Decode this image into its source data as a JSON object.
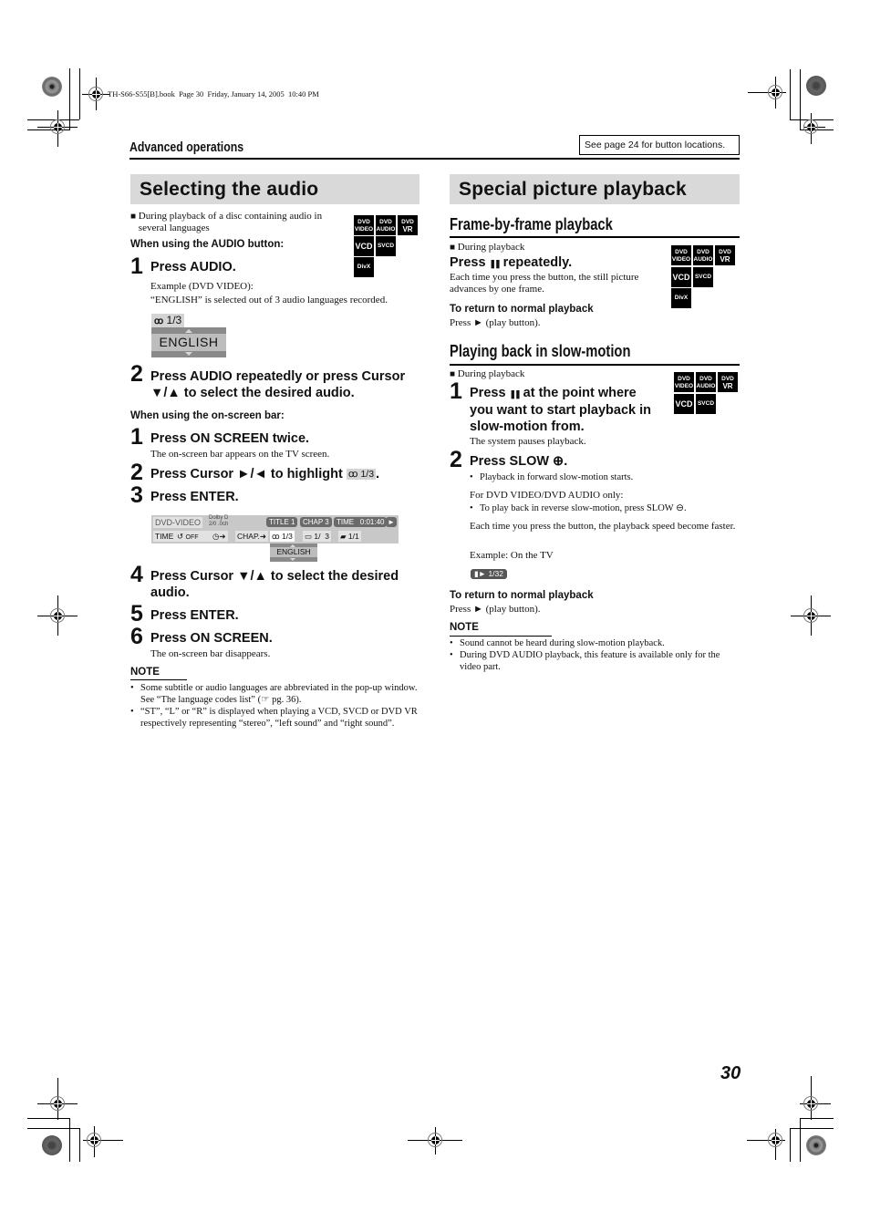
{
  "print_slug": "TH-S66-S55[B].book  Page 30  Friday, January 14, 2005  10:40 PM",
  "header": {
    "section": "Advanced operations",
    "button_note": "See page 24 for button locations."
  },
  "left": {
    "title": "Selecting the audio",
    "condition": "During playback of a disc containing audio in several languages",
    "discs": [
      "DVD VIDEO",
      "DVD AUDIO",
      "DVD VR",
      "VCD",
      "SVCD",
      "DivX"
    ],
    "disc_labels": {
      "dvd_video": [
        "DVD",
        "VIDEO"
      ],
      "dvd_audio": [
        "DVD",
        "AUDIO"
      ],
      "dvd_vr": [
        "DVD",
        "VR"
      ],
      "vcd": "VCD",
      "svcd": "SVCD",
      "divx": "DivX"
    },
    "audio_button_heading": "When using the AUDIO button:",
    "audio_steps": [
      {
        "num": "1",
        "text": "Press AUDIO.",
        "detail": [
          "Example (DVD VIDEO):",
          "“ENGLISH” is selected out of 3 audio languages recorded."
        ]
      },
      {
        "num": "2",
        "text": "Press AUDIO repeatedly or press Cursor ▼/▲ to select the desired audio."
      }
    ],
    "osd_example": {
      "counter": "1/3",
      "language": "ENGLISH"
    },
    "onscreen_heading": "When using the on-screen bar:",
    "onscreen_steps": [
      {
        "num": "1",
        "text": "Press ON SCREEN twice.",
        "detail": "The on-screen bar appears on the TV screen."
      },
      {
        "num": "2",
        "text": "Press Cursor ►/◄ to highlight",
        "badge": "1/3",
        "suffix": "."
      },
      {
        "num": "3",
        "text": "Press ENTER."
      },
      {
        "num": "4",
        "text": "Press Cursor ▼/▲ to select the desired audio."
      },
      {
        "num": "5",
        "text": "Press ENTER."
      },
      {
        "num": "6",
        "text": "Press ON SCREEN.",
        "detail": "The on-screen bar disappears."
      }
    ],
    "onscreen_bar": {
      "disc_type": "DVD-VIDEO",
      "audio_format": [
        "Dolby D",
        "2/0 .0ch"
      ],
      "title": "TITLE  1",
      "chapter": "CHAP  3",
      "time": "TIME   0:01:40",
      "play_icon": "►",
      "time_btn": "TIME",
      "repeat": "OFF",
      "chap_btn": "CHAP.➜",
      "audio": "1/3",
      "subtitle": "1/  3",
      "angle": "1/1",
      "popup_language": "ENGLISH"
    },
    "note_label": "NOTE",
    "notes": [
      "Some subtitle or audio languages are abbreviated in the pop-up window. See “The language codes list” (☞ pg. 36).",
      "“ST”, “L” or “R” is displayed when playing a VCD, SVCD or DVD VR respectively representing “stereo”, “left sound” and “right sound”."
    ]
  },
  "right": {
    "title": "Special picture playback",
    "frame": {
      "heading": "Frame-by-frame playback",
      "condition": "During playback",
      "step_prefix": "Press",
      "step_icon": "❚❚",
      "step_suffix": "repeatedly.",
      "description": "Each time you press the button, the still picture advances by one frame.",
      "return_heading": "To return to normal playback",
      "return_text": "Press ► (play button)."
    },
    "slow": {
      "heading": "Playing back in slow-motion",
      "condition": "During playback",
      "step1_prefix": "Press",
      "step1_icon": "❚❚",
      "step1_suffix": "at the point where you want to start playback in slow-motion from.",
      "step1_line1": "at the point where",
      "step1_line2": "you want to start playback in",
      "step1_line3": "slow-motion from.",
      "step1_detail": "The system pauses playback.",
      "step2_text": "Press SLOW ⊕.",
      "step2_bullet": "Playback in forward slow-motion starts.",
      "dvd_only": "For DVD VIDEO/DVD AUDIO only:",
      "reverse_bullet": "To play back in reverse slow-motion, press SLOW ⊖.",
      "speed_text": "Each time you press the button, the playback speed become faster.",
      "example": "Example: On the TV",
      "tv_badge": "▮► 1/32",
      "return_heading": "To return to normal playback",
      "return_text": "Press ► (play button).",
      "note_label": "NOTE",
      "notes": [
        "Sound cannot be heard during slow-motion playback.",
        "During DVD AUDIO playback, this feature is available only for the video part."
      ]
    }
  },
  "page_number": "30"
}
